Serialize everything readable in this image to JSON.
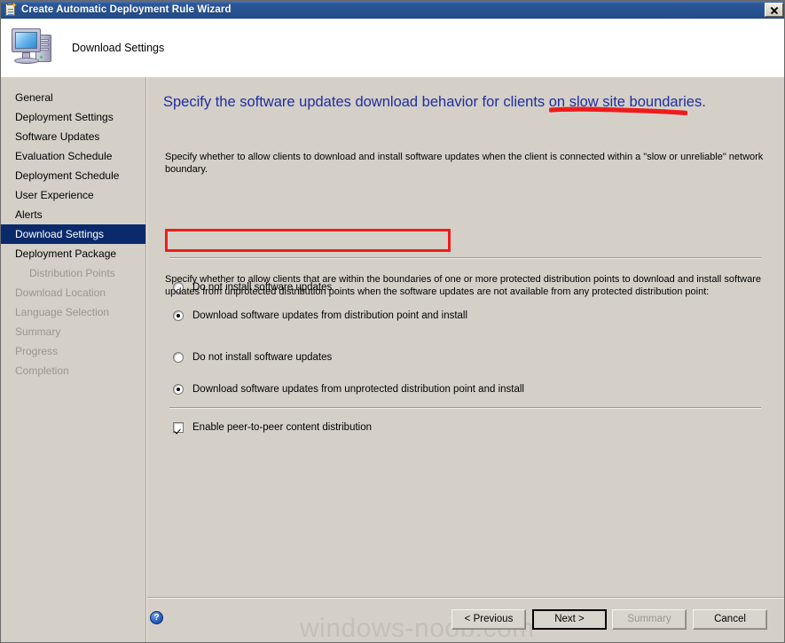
{
  "window": {
    "title": "Create Automatic Deployment Rule Wizard",
    "titlebar_icon": "wizard-clipboard-icon",
    "close_label": "close-icon"
  },
  "header": {
    "title": "Download Settings",
    "icon": "computer-icon"
  },
  "sidebar": {
    "items": [
      {
        "label": "General",
        "state": "normal"
      },
      {
        "label": "Deployment Settings",
        "state": "normal"
      },
      {
        "label": "Software Updates",
        "state": "normal"
      },
      {
        "label": "Evaluation Schedule",
        "state": "normal"
      },
      {
        "label": "Deployment Schedule",
        "state": "normal"
      },
      {
        "label": "User Experience",
        "state": "normal"
      },
      {
        "label": "Alerts",
        "state": "normal"
      },
      {
        "label": "Download Settings",
        "state": "selected"
      },
      {
        "label": "Deployment Package",
        "state": "normal"
      },
      {
        "label": "Distribution Points",
        "state": "disabled-indent"
      },
      {
        "label": "Download Location",
        "state": "disabled"
      },
      {
        "label": "Language Selection",
        "state": "disabled"
      },
      {
        "label": "Summary",
        "state": "disabled"
      },
      {
        "label": "Progress",
        "state": "disabled"
      },
      {
        "label": "Completion",
        "state": "disabled"
      }
    ]
  },
  "content": {
    "heading": "Specify the software updates download behavior for clients on slow site boundaries.",
    "description_1": "Specify whether to allow clients to download and install software updates when the client is connected within a \"slow or unreliable\" network boundary.",
    "group_1": {
      "option_1": "Do not install software updates",
      "option_1_mnemonic": "t",
      "option_1_selected": false,
      "option_2": "Download software updates from distribution point and install",
      "option_2_mnemonic": "D",
      "option_2_selected": true
    },
    "description_2": "Specify whether to allow clients that are within the boundaries of one or more protected distribution points to download and install software updates from unprotected distribution points when the software updates are not available from any protected distribution point:",
    "group_2": {
      "option_1": "Do not install software updates",
      "option_1_mnemonic": "o",
      "option_1_selected": false,
      "option_2": "Download software updates from unprotected distribution point and install",
      "option_2_mnemonic": "u",
      "option_2_selected": true
    },
    "checkbox": {
      "label": "Enable peer-to-peer content distribution",
      "checked": true
    }
  },
  "footer": {
    "help_glyph": "?",
    "watermark": "windows-noob.com",
    "buttons": [
      {
        "label": "< Previous",
        "state": "normal"
      },
      {
        "label": "Next >",
        "state": "default"
      },
      {
        "label": "Summary",
        "state": "disabled"
      },
      {
        "label": "Cancel",
        "state": "normal"
      }
    ]
  },
  "annotations": {
    "highlight_rect_target": "Download software updates from distribution point and install",
    "underline_target": "slow site boundaries.",
    "color": "#ee1c1c"
  }
}
